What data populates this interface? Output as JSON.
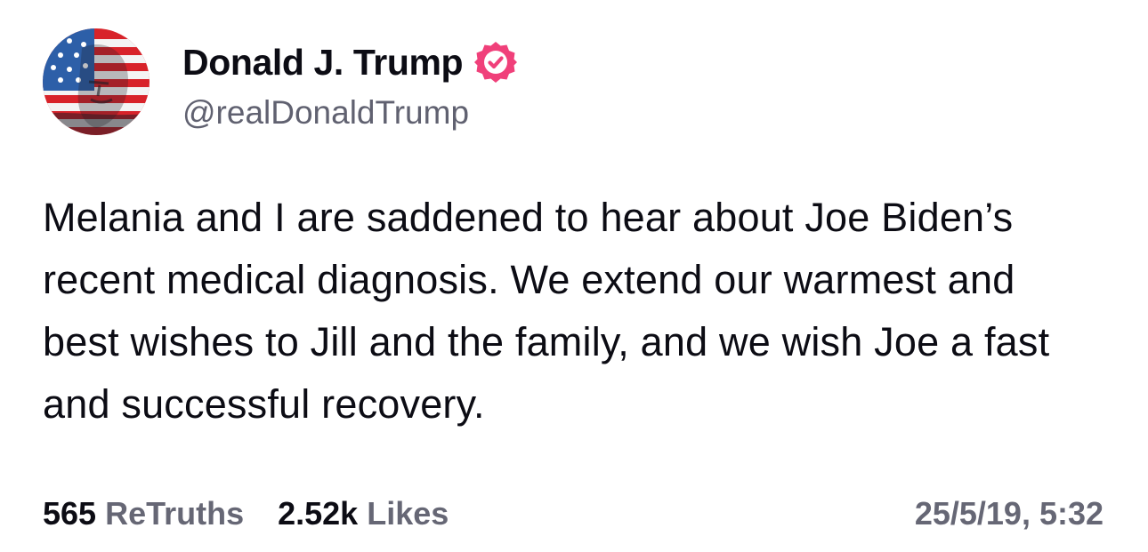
{
  "author": {
    "display_name": "Donald J. Trump",
    "handle": "@realDonaldTrump",
    "verified_icon": "verified-badge-icon",
    "verified_color": "#f0407a"
  },
  "post": {
    "text": "Melania and I are saddened to hear about Joe Biden’s recent medical diagnosis. We extend our warmest and best wishes to Jill and the family, and we wish Joe a fast and successful recovery."
  },
  "stats": {
    "retruths_count": "565",
    "retruths_label": "ReTruths",
    "likes_count": "2.52k",
    "likes_label": "Likes"
  },
  "timestamp": "25/5/19, 5:32"
}
